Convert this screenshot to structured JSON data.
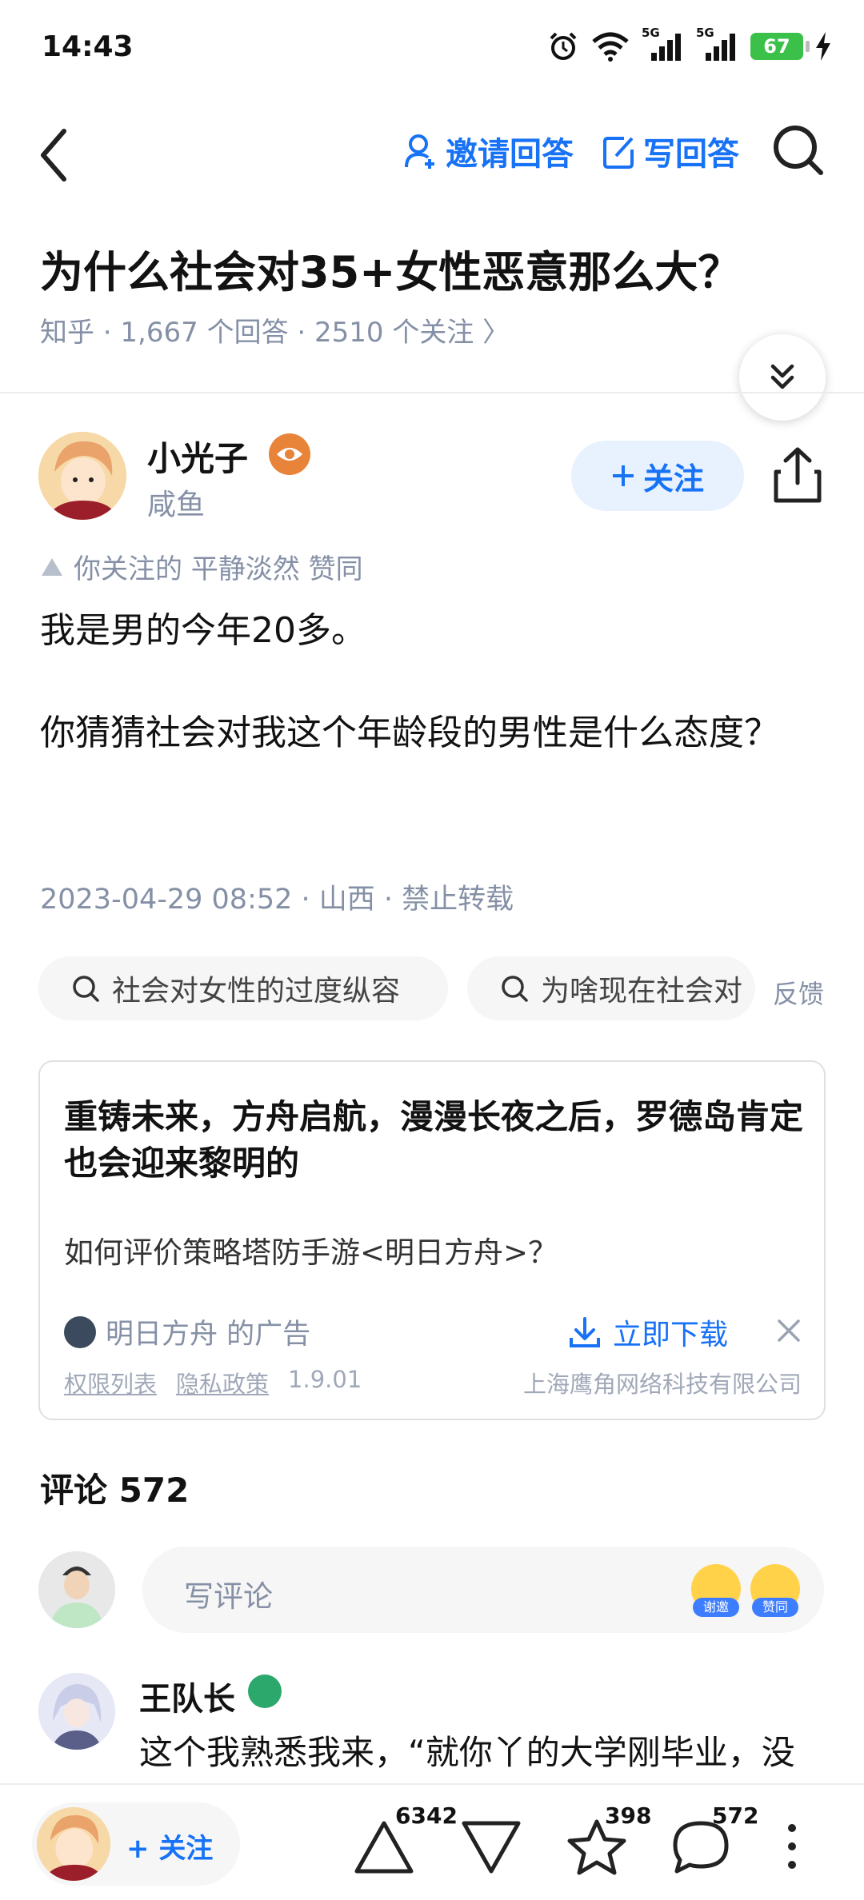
{
  "status": {
    "time": "14:43",
    "signal1": "5G",
    "signal2": "5G",
    "battery": "67"
  },
  "nav": {
    "invite_label": "邀请回答",
    "write_label": "写回答"
  },
  "question": {
    "title": "为什么社会对35+女性恶意那么大？",
    "meta": "知乎 · 1,667 个回答 · 2510 个关注 〉"
  },
  "author": {
    "name": "小光子",
    "subtitle": "咸鱼",
    "follow_label": "关注",
    "endorse": "你关注的 平静淡然 赞同"
  },
  "answer": {
    "p1": "我是男的今年20多。",
    "p2": "你猜猜社会对我这个年龄段的男性是什么态度？",
    "meta": "2023-04-29 08:52 · 山西 · 禁止转载"
  },
  "tags": [
    "社会对女性的过度纵容",
    "为啥现在社会对"
  ],
  "feedback_label": "反馈",
  "ad": {
    "title": "重铸未来，方舟启航，漫漫长夜之后，罗德岛肯定也会迎来黎明的",
    "subtitle": "如何评价策略塔防手游<明日方舟>？",
    "brand": "明日方舟 的广告",
    "download_label": "立即下载",
    "link1": "权限列表",
    "link2": "隐私政策",
    "version": "1.9.01",
    "company": "上海鹰角网络科技有限公司"
  },
  "comments": {
    "header": "评论 572",
    "placeholder": "写评论",
    "emoji1": "谢邀",
    "emoji2": "赞同",
    "first": {
      "name": "王队长",
      "text": "这个我熟悉我来，“就你丫的大学刚毕业，没"
    }
  },
  "bottom": {
    "follow_label": "+ 关注",
    "upvotes": "6342",
    "favorites": "398",
    "comments": "572"
  },
  "colors": {
    "accent": "#1772f6",
    "muted": "#8590a6",
    "battery": "#3bc14a"
  }
}
